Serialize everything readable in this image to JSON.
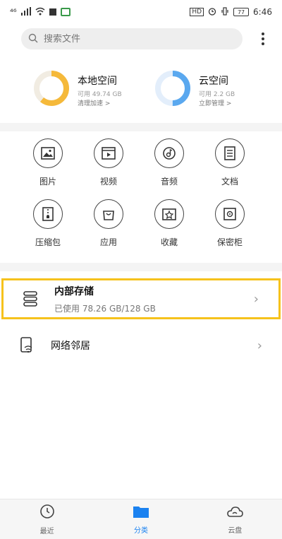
{
  "statusbar": {
    "signal": "⁴⁶",
    "time": "6:46",
    "battery": "77",
    "hd": "HD"
  },
  "search": {
    "placeholder": "搜索文件"
  },
  "local": {
    "title": "本地空间",
    "available": "可用 49.74 GB",
    "action": "清理加速 >"
  },
  "cloud": {
    "title": "云空间",
    "available": "可用 2.2 GB",
    "action": "立即管理 >"
  },
  "categories": [
    "图片",
    "视频",
    "音频",
    "文档",
    "压缩包",
    "应用",
    "收藏",
    "保密柜"
  ],
  "internal": {
    "title": "内部存储",
    "usage": "已使用 78.26 GB/128 GB"
  },
  "network": {
    "title": "网络邻居"
  },
  "nav": {
    "recent": "最近",
    "category": "分类",
    "cloud": "云盘"
  },
  "colors": {
    "accent": "#1b82f0",
    "local_ring": "#f5b93a",
    "cloud_ring": "#5aa8ef",
    "highlight": "#f6c21c"
  },
  "progress": {
    "local_used": 0.61,
    "cloud_used": 0.5
  }
}
